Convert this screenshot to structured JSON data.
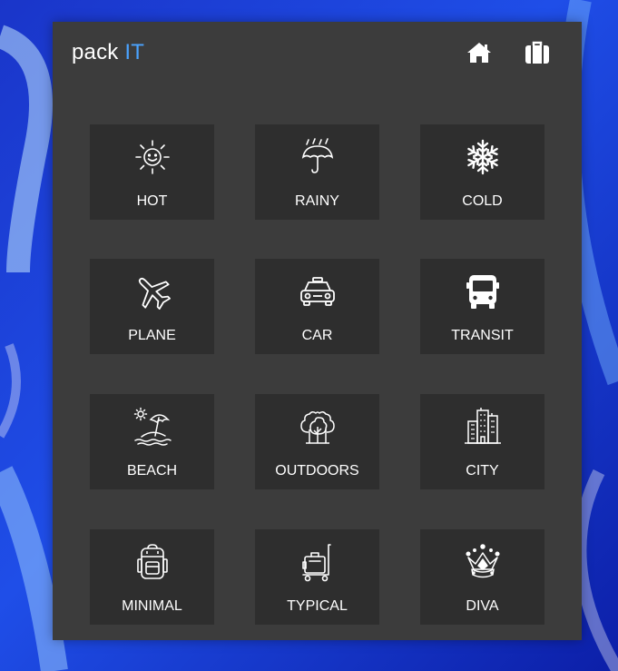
{
  "app": {
    "logo_main": "pack",
    "logo_accent": "IT",
    "accent_color": "#4aa3ff",
    "panel_color": "#3c3c3c",
    "tile_color": "#2e2e2e"
  },
  "nav": {
    "home_icon": "home-icon",
    "suitcase_icon": "suitcase-icon"
  },
  "tiles": [
    {
      "label": "HOT",
      "icon": "sun-icon"
    },
    {
      "label": "RAINY",
      "icon": "umbrella-rain-icon"
    },
    {
      "label": "COLD",
      "icon": "snowflake-icon"
    },
    {
      "label": "PLANE",
      "icon": "airplane-icon"
    },
    {
      "label": "CAR",
      "icon": "car-icon"
    },
    {
      "label": "TRANSIT",
      "icon": "bus-icon"
    },
    {
      "label": "BEACH",
      "icon": "beach-umbrella-icon"
    },
    {
      "label": "OUTDOORS",
      "icon": "trees-icon"
    },
    {
      "label": "CITY",
      "icon": "buildings-icon"
    },
    {
      "label": "MINIMAL",
      "icon": "backpack-icon"
    },
    {
      "label": "TYPICAL",
      "icon": "luggage-cart-icon"
    },
    {
      "label": "DIVA",
      "icon": "crown-icon"
    }
  ]
}
